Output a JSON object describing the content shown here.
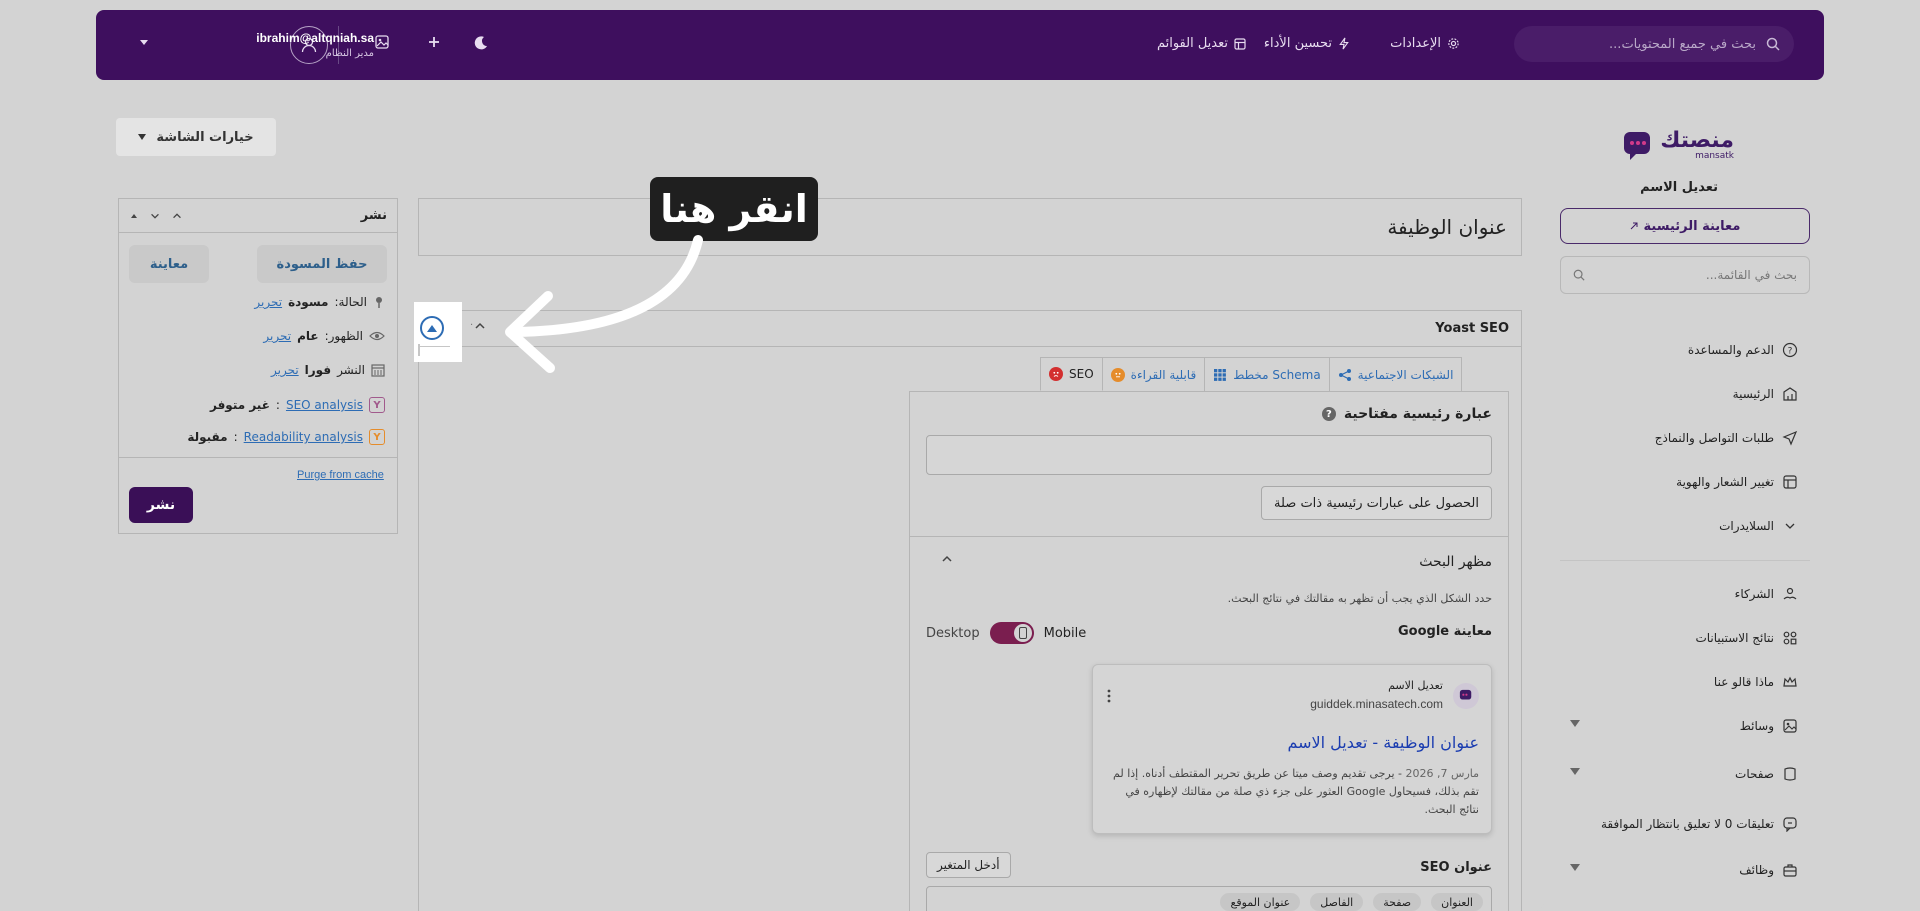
{
  "header": {
    "search_placeholder": "بحث في جميع المحتويات...",
    "links": {
      "settings": "الإعدادات",
      "performance": "تحسين الأداء",
      "menus": "تعديل القوائم"
    },
    "user": {
      "email": "ibrahim@altqniah.sa",
      "role": "مدير النظام"
    }
  },
  "sidebar": {
    "logo_text": "منصتك",
    "logo_sub": "mansatk",
    "site_name": "تعديل الاسم",
    "preview_home": "معاينة الرئيسية",
    "search_placeholder": "بحث في القائمة...",
    "items": [
      {
        "label": "الدعم والمساعدة"
      },
      {
        "label": "الرئيسية"
      },
      {
        "label": "طلبات التواصل والنماذج"
      },
      {
        "label": "تغيير الشعار والهوية"
      },
      {
        "label": "السلايدرات"
      },
      {
        "label": "الشركاء"
      },
      {
        "label": "نتائج الاستبيانات"
      },
      {
        "label": "ماذا قالو عنا"
      },
      {
        "label": "وسائط"
      },
      {
        "label": "صفحات"
      },
      {
        "label": "تعليقات 0 لا تعليق بانتظار الموافقة"
      },
      {
        "label": "وظائف"
      }
    ]
  },
  "main": {
    "screen_options": "خيارات الشاشة",
    "title_placeholder": "عنوان الوظيفة",
    "yoast": {
      "title": "Yoast SEO",
      "tabs": [
        "SEO",
        "قابلية القراءة",
        "Schema مخطط",
        "الشبكات الاجتماعية"
      ],
      "keyphrase_label": "عبارة رئيسية مفتاحية",
      "related_btn": "الحصول على عبارات رئيسية ذات صلة",
      "search_appearance": "مظهر البحث",
      "search_desc": "حدد الشكل الذي يجب أن تظهر به مقالتك في نتائج البحث.",
      "google_preview": "معاينة Google",
      "mode_mobile": "Mobile",
      "mode_desktop": "Desktop",
      "card": {
        "site": "تعديل الاسم",
        "url": "guiddek.minasatech.com",
        "title": "عنوان الوظيفة - تعديل الاسم",
        "date": "مارس 7, 2026",
        "desc": "- يرجى تقديم وصف ميتا عن طريق تحرير المقتطف أدناه. إذا لم تقم بذلك، فسيحاول Google العثور على جزء ذي صلة من مقالتك لإظهاره في نتائج البحث."
      },
      "seo_title_label": "عنوان SEO",
      "insert_var": "أدخل المتغير",
      "vars": [
        "العنوان",
        "صفحة",
        "الفاصل",
        "عنوان الموقع"
      ]
    }
  },
  "publish": {
    "title": "نشر",
    "save_draft": "حفظ المسودة",
    "preview": "معاينة",
    "status_label": "الحالة:",
    "status_value": "مسودة",
    "visibility_label": "الظهور:",
    "visibility_value": "عام",
    "publish_label": "النشر",
    "publish_value": "فورا",
    "edit": "تحرير",
    "seo_analysis": "SEO analysis",
    "seo_value": "غير متوفر",
    "readability_analysis": "Readability analysis",
    "readability_value": "مقبولة",
    "purge": "Purge from cache",
    "publish_btn": "نشر"
  },
  "tooltip": {
    "text": "انقر هنا"
  },
  "colors": {
    "header_bg": "#3e0f5e",
    "accent": "#3a0f57",
    "toggle": "#7a1e4f",
    "link": "#2d6cb4"
  }
}
